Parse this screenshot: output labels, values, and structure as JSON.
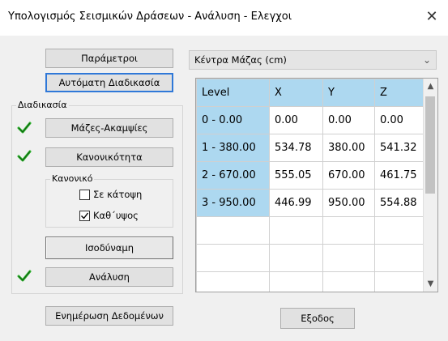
{
  "window": {
    "title": "Υπολογισμός Σεισμικών Δράσεων - Ανάλυση - Ελεγχοι",
    "close_glyph": "✕"
  },
  "buttons": {
    "parameters": "Παράμετροι",
    "auto_procedure": "Αυτόματη Διαδικασία",
    "masses": "Μάζες-Ακαμψίες",
    "regularity": "Κανονικότητα",
    "equivalent": "Ισοδύναμη",
    "analysis": "Ανάλυση",
    "update_data": "Ενημέρωση Δεδομένων",
    "exit": "Εξοδος"
  },
  "procedure_group": {
    "label": "Διαδικασία"
  },
  "regular_group": {
    "label": "Κανονικό",
    "in_plan": {
      "label": "Σε κάτοψη",
      "checked": false
    },
    "in_height": {
      "label": "Καθ΄υψος",
      "checked": true
    }
  },
  "status_checks": {
    "masses_done": true,
    "regularity_done": true,
    "analysis_done": true,
    "color": "#2fb12f"
  },
  "combo": {
    "selected": "Κέντρα Μάζας (cm)"
  },
  "grid": {
    "columns": [
      "Level",
      "X",
      "Y",
      "Z"
    ],
    "rows": [
      [
        "0 - 0.00",
        "0.00",
        "0.00",
        "0.00"
      ],
      [
        "1 - 380.00",
        "534.78",
        "380.00",
        "541.32"
      ],
      [
        "2 - 670.00",
        "555.05",
        "670.00",
        "461.75"
      ],
      [
        "3 - 950.00",
        "446.99",
        "950.00",
        "554.88"
      ]
    ],
    "header_color": "#add8f0"
  }
}
